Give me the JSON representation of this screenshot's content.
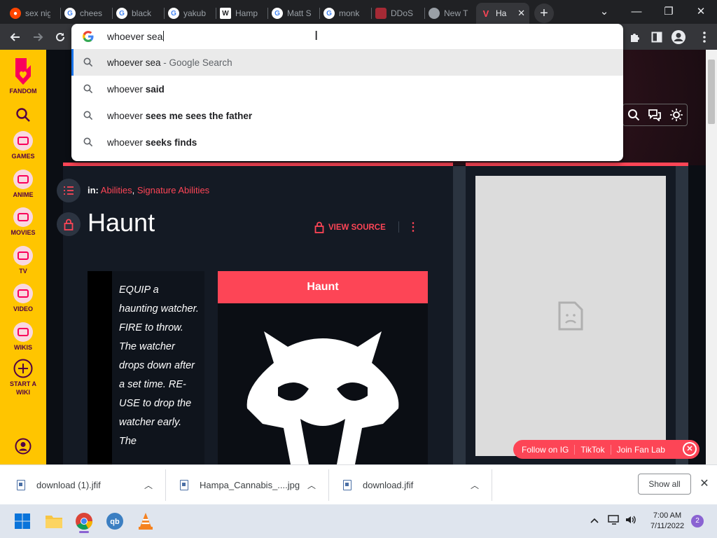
{
  "browser": {
    "tabs": [
      {
        "title": "sex nig",
        "favicon": "reddit-icon",
        "color": "#ff4500"
      },
      {
        "title": "chees",
        "favicon": "google-icon",
        "color": "#ffffff"
      },
      {
        "title": "black",
        "favicon": "google-icon",
        "color": "#ffffff"
      },
      {
        "title": "yakub",
        "favicon": "google-icon",
        "color": "#ffffff"
      },
      {
        "title": "Hamp",
        "favicon": "wikipedia-icon",
        "color": "#ffffff"
      },
      {
        "title": "Matt S",
        "favicon": "google-icon",
        "color": "#ffffff"
      },
      {
        "title": "monk",
        "favicon": "google-icon",
        "color": "#ffffff"
      },
      {
        "title": "DDoS",
        "favicon": "ddos-site-icon",
        "color": "#a52a35"
      },
      {
        "title": "New T",
        "favicon": "chrome-icon",
        "color": "#9aa0a6"
      },
      {
        "title": "Ha",
        "favicon": "valorant-icon",
        "color": "#fd4556"
      }
    ],
    "new_tab_label": "+",
    "window_controls": {
      "dropdown": "⌄",
      "minimize": "—",
      "maximize": "❐",
      "close": "✕"
    }
  },
  "omnibox": {
    "typed_text": "whoever sea",
    "suggestions": [
      {
        "prefix": "whoever sea",
        "bold": "",
        "suffix": " - Google Search"
      },
      {
        "prefix": "whoever ",
        "bold": "said",
        "suffix": ""
      },
      {
        "prefix": "whoever ",
        "bold": "sees me sees the father",
        "suffix": ""
      },
      {
        "prefix": "whoever ",
        "bold": "seeks finds",
        "suffix": ""
      }
    ]
  },
  "fandom_rail": {
    "brand": "FANDOM",
    "items": [
      "GAMES",
      "ANIME",
      "MOVIES",
      "TV",
      "VIDEO",
      "WIKIS"
    ],
    "start_wiki": "START A WIKI"
  },
  "article": {
    "categories_prefix": "in:",
    "categories": [
      "Abilities",
      "Signature Abilities"
    ],
    "title": "Haunt",
    "view_source": "VIEW SOURCE",
    "description": "EQUIP a haunting watcher. FIRE to throw. The watcher drops down after a set time. RE-USE to drop the watcher early. The",
    "infobox_title": "Haunt"
  },
  "fan_bar": {
    "links": [
      "Follow on IG",
      "TikTok",
      "Join Fan Lab"
    ]
  },
  "downloads": {
    "items": [
      "download (1).jfif",
      "Hampa_Cannabis_....jpg",
      "download.jfif"
    ],
    "show_all": "Show all"
  },
  "taskbar": {
    "time": "7:00 AM",
    "date": "7/11/2022",
    "notifications": "2"
  },
  "colors": {
    "accent": "#fd4556",
    "fandom_yellow": "#ffc500",
    "chrome_dark": "#202124"
  }
}
